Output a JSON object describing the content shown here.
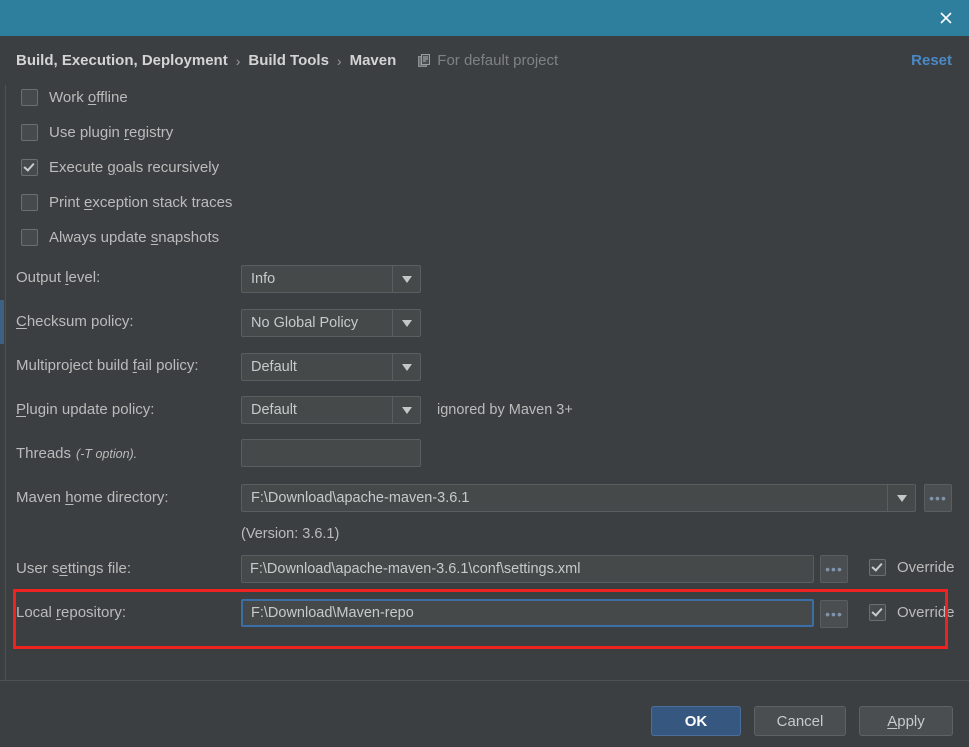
{
  "titlebar": {
    "close_label": "✕"
  },
  "header": {
    "breadcrumb": [
      "Build, Execution, Deployment",
      "Build Tools",
      "Maven"
    ],
    "separator": "›",
    "scope_label": "For default project",
    "scope_icon": "project-scope-icon",
    "reset_label": "Reset"
  },
  "checkboxes": [
    {
      "label_before": "Work ",
      "mnemonic": "o",
      "label_after": "ffline",
      "checked": false,
      "name": "work-offline"
    },
    {
      "label_before": "Use plugin ",
      "mnemonic": "r",
      "label_after": "egistry",
      "checked": false,
      "name": "use-plugin-registry"
    },
    {
      "label_before": "Execute ",
      "mnemonic": "g",
      "label_after": "oals recursively",
      "checked": true,
      "name": "execute-goals-recursively"
    },
    {
      "label_before": "Print ",
      "mnemonic": "e",
      "label_after": "xception stack traces",
      "checked": false,
      "name": "print-exception-stack-traces"
    },
    {
      "label_before": "Always update ",
      "mnemonic": "s",
      "label_after": "napshots",
      "checked": false,
      "name": "always-update-snapshots"
    }
  ],
  "combos": [
    {
      "label_before": "Output ",
      "mnemonic": "l",
      "label_after": "evel:",
      "value": "Info",
      "name": "output-level"
    },
    {
      "label_before": "",
      "mnemonic": "C",
      "label_after": "hecksum policy:",
      "value": "No Global Policy",
      "name": "checksum-policy"
    },
    {
      "label_before": "Multiproject build ",
      "mnemonic": "f",
      "label_after": "ail policy:",
      "value": "Default",
      "name": "multiproject-build-fail-policy"
    },
    {
      "label_before": "",
      "mnemonic": "P",
      "label_after": "lugin update policy:",
      "value": "Default",
      "name": "plugin-update-policy",
      "note": "ignored by Maven 3+"
    }
  ],
  "threads": {
    "label": "Threads",
    "hint": "(-T option).",
    "value": ""
  },
  "maven_home": {
    "label_before": "Maven ",
    "mnemonic": "h",
    "label_after": "ome directory:",
    "value": "F:\\Download\\apache-maven-3.6.1",
    "version_note": "(Version: 3.6.1)",
    "browse_label": "•••"
  },
  "user_settings": {
    "label_before": "User s",
    "mnemonic": "e",
    "label_after": "ttings file:",
    "value": "F:\\Download\\apache-maven-3.6.1\\conf\\settings.xml",
    "browse_label": "•••",
    "override_label": "Override",
    "override_checked": true
  },
  "local_repository": {
    "label_before": "Local ",
    "mnemonic": "r",
    "label_after": "epository:",
    "value": "F:\\Download\\Maven-repo",
    "browse_label": "•••",
    "override_label": "Override",
    "override_checked": true
  },
  "footer": {
    "ok_label": "OK",
    "cancel_label": "Cancel",
    "apply_before": "",
    "apply_mnemonic": "A",
    "apply_after": "pply"
  },
  "colors": {
    "titlebar": "#2d7f9d",
    "background": "#3c3f41",
    "accent_link": "#4a88c7",
    "primary_button": "#365880",
    "annotation": "#ef2222",
    "focus_border": "#3a6ea5"
  }
}
